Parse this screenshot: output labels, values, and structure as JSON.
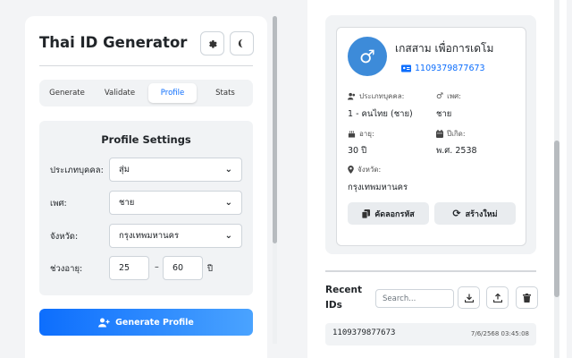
{
  "app": {
    "title": "Thai ID Generator"
  },
  "header": {
    "settings_icon": "gear-icon",
    "theme_icon": "moon-icon"
  },
  "tabs": [
    {
      "label": "Generate"
    },
    {
      "label": "Validate"
    },
    {
      "label": "Profile",
      "active": true
    },
    {
      "label": "Stats"
    }
  ],
  "settings": {
    "title": "Profile Settings",
    "person_type": {
      "label": "ประเภทบุคคล:",
      "value": "สุ่ม"
    },
    "gender": {
      "label": "เพศ:",
      "value": "ชาย"
    },
    "province": {
      "label": "จังหวัด:",
      "value": "กรุงเทพมหานคร"
    },
    "age_range": {
      "label": "ช่วงอายุ:",
      "min": "25",
      "separator": "–",
      "max": "60",
      "unit": "ปี"
    }
  },
  "generate_button": {
    "label": "Generate Profile"
  },
  "profile": {
    "name": "เกสสาม เพื่อการเดโม",
    "id": "1109379877673",
    "fields": {
      "person_type": {
        "label": "ประเภทบุคคล:",
        "value": "1 - คนไทย (ชาย)"
      },
      "gender": {
        "label": "เพศ:",
        "value": "ชาย"
      },
      "age": {
        "label": "อายุ:",
        "value": "30 ปี"
      },
      "birth_year": {
        "label": "ปีเกิด:",
        "value": "พ.ศ. 2538"
      },
      "province": {
        "label": "จังหวัด:",
        "value": "กรุงเทพมหานคร"
      }
    },
    "copy_button": "คัดลอกรหัส",
    "regenerate_button": "สร้างใหม่"
  },
  "recent": {
    "title": "Recent IDs",
    "search_placeholder": "Search...",
    "items": [
      {
        "id": "1109379877673",
        "date": "7/6/2568 03:45:08"
      }
    ]
  },
  "colors": {
    "accent": "#0d6efd",
    "avatar": "#3d8bd9",
    "panel_bg": "#f1f3f5"
  }
}
